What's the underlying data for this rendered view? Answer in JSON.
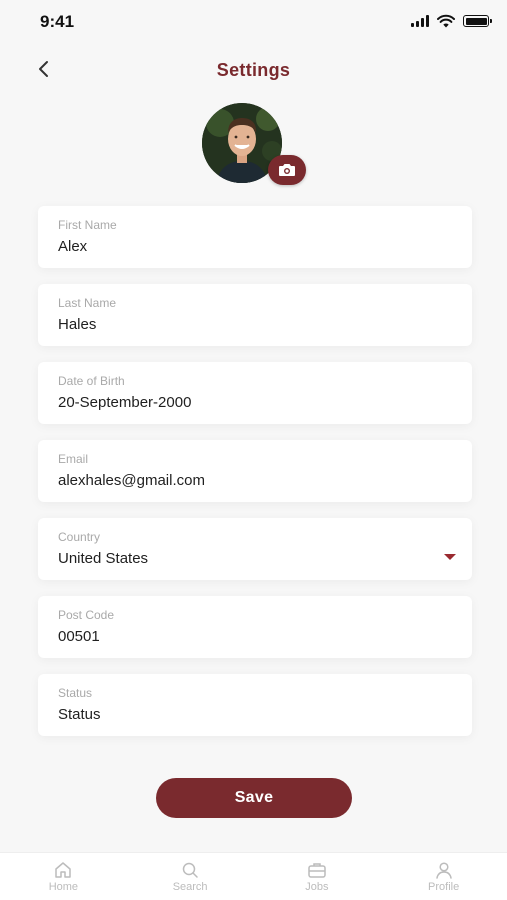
{
  "status_bar": {
    "time": "9:41"
  },
  "header": {
    "title": "Settings"
  },
  "colors": {
    "accent": "#7a2a2e",
    "background": "#f7f7f7",
    "label": "#a9a9a9"
  },
  "fields": [
    {
      "label": "First Name",
      "value": "Alex"
    },
    {
      "label": "Last Name",
      "value": "Hales"
    },
    {
      "label": "Date of Birth",
      "value": "20-September-2000"
    },
    {
      "label": "Email",
      "value": "alexhales@gmail.com"
    },
    {
      "label": "Country",
      "value": "United States"
    },
    {
      "label": "Post Code",
      "value": "00501"
    },
    {
      "label": "Status",
      "value": "Status"
    }
  ],
  "save_label": "Save",
  "tabs": [
    {
      "label": "Home",
      "icon": "home-icon"
    },
    {
      "label": "Search",
      "icon": "search-icon"
    },
    {
      "label": "Jobs",
      "icon": "briefcase-icon"
    },
    {
      "label": "Profile",
      "icon": "user-icon"
    }
  ]
}
